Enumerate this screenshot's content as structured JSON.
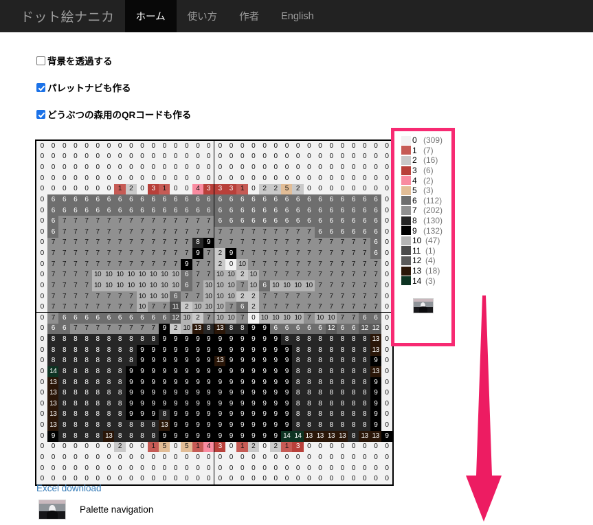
{
  "navbar": {
    "brand": "ドット絵ナニカ",
    "items": [
      {
        "label": "ホーム",
        "active": true
      },
      {
        "label": "使い方",
        "active": false
      },
      {
        "label": "作者",
        "active": false
      },
      {
        "label": "English",
        "active": false
      }
    ]
  },
  "options": [
    {
      "label": "背景を透過する",
      "checked": false
    },
    {
      "label": "パレットナビも作る",
      "checked": true
    },
    {
      "label": "どうぶつの森用のQRコードも作る",
      "checked": true
    }
  ],
  "legend": {
    "border_color": "#f72a72",
    "entries": [
      {
        "index": "0",
        "count": "(309)",
        "color": "#f2f2f2"
      },
      {
        "index": "1",
        "count": "(7)",
        "color": "#c65b55"
      },
      {
        "index": "2",
        "count": "(16)",
        "color": "#c9c9c9"
      },
      {
        "index": "3",
        "count": "(6)",
        "color": "#b8403a"
      },
      {
        "index": "4",
        "count": "(2)",
        "color": "#f98ba0"
      },
      {
        "index": "5",
        "count": "(3)",
        "color": "#e2bd96"
      },
      {
        "index": "6",
        "count": "(112)",
        "color": "#6e6e6e"
      },
      {
        "index": "7",
        "count": "(202)",
        "color": "#909090"
      },
      {
        "index": "8",
        "count": "(130)",
        "color": "#262626"
      },
      {
        "index": "9",
        "count": "(132)",
        "color": "#000000"
      },
      {
        "index": "10",
        "count": "(47)",
        "color": "#b4b4b4"
      },
      {
        "index": "11",
        "count": "(1)",
        "color": "#4b4b4b"
      },
      {
        "index": "12",
        "count": "(4)",
        "color": "#5a5a5a"
      },
      {
        "index": "13",
        "count": "(18)",
        "color": "#2a1608"
      },
      {
        "index": "14",
        "count": "(3)",
        "color": "#0d3322"
      }
    ],
    "thumbnail_name": "palette-navigation-thumbnail"
  },
  "links": {
    "excel_download": "Excel download",
    "palette_navigation": "Palette navigation"
  },
  "arrow": {
    "color": "#ed1c62",
    "direction": "down"
  },
  "grid": {
    "rows": 32,
    "cols": 32,
    "block_divider_col": 16,
    "block_divider_row": 16,
    "palette": {
      "0": "#f2f2f2",
      "1": "#c65b55",
      "2": "#c9c9c9",
      "3": "#b8403a",
      "4": "#f98ba0",
      "5": "#e2bd96",
      "6": "#6e6e6e",
      "7": "#909090",
      "8": "#262626",
      "9": "#000000",
      "10": "#b4b4b4",
      "11": "#4b4b4b",
      "12": "#5a5a5a",
      "13": "#2a1608",
      "14": "#0d3322"
    },
    "cells": [
      [
        0,
        0,
        0,
        0,
        0,
        0,
        0,
        0,
        0,
        0,
        0,
        0,
        0,
        0,
        0,
        0,
        0,
        0,
        0,
        0,
        0,
        0,
        0,
        0,
        0,
        0,
        0,
        0,
        0,
        0,
        0,
        0
      ],
      [
        0,
        0,
        0,
        0,
        0,
        0,
        0,
        0,
        0,
        0,
        0,
        0,
        0,
        0,
        0,
        0,
        0,
        0,
        0,
        0,
        0,
        0,
        0,
        0,
        0,
        0,
        0,
        0,
        0,
        0,
        0,
        0
      ],
      [
        0,
        0,
        0,
        0,
        0,
        0,
        0,
        0,
        0,
        0,
        0,
        0,
        0,
        0,
        0,
        0,
        0,
        0,
        0,
        0,
        0,
        0,
        0,
        0,
        0,
        0,
        0,
        0,
        0,
        0,
        0,
        0
      ],
      [
        0,
        0,
        0,
        0,
        0,
        0,
        0,
        0,
        0,
        0,
        0,
        0,
        0,
        0,
        0,
        0,
        0,
        0,
        0,
        0,
        0,
        0,
        0,
        0,
        0,
        0,
        0,
        0,
        0,
        0,
        0,
        0
      ],
      [
        0,
        0,
        0,
        0,
        0,
        0,
        0,
        1,
        2,
        0,
        3,
        1,
        0,
        0,
        4,
        3,
        3,
        3,
        1,
        0,
        2,
        2,
        5,
        2,
        0,
        0,
        0,
        0,
        0,
        0,
        0,
        0
      ],
      [
        0,
        6,
        6,
        6,
        6,
        6,
        6,
        6,
        6,
        6,
        6,
        6,
        6,
        6,
        6,
        6,
        6,
        6,
        6,
        6,
        6,
        6,
        6,
        6,
        6,
        6,
        6,
        6,
        6,
        6,
        6,
        0
      ],
      [
        0,
        6,
        6,
        6,
        6,
        6,
        6,
        6,
        6,
        6,
        6,
        6,
        6,
        6,
        6,
        6,
        6,
        6,
        6,
        6,
        6,
        6,
        6,
        6,
        6,
        6,
        6,
        6,
        6,
        6,
        6,
        0
      ],
      [
        0,
        6,
        7,
        7,
        7,
        7,
        7,
        7,
        7,
        7,
        7,
        7,
        7,
        7,
        7,
        7,
        6,
        6,
        6,
        6,
        6,
        6,
        6,
        6,
        6,
        6,
        6,
        6,
        6,
        6,
        6,
        0
      ],
      [
        0,
        6,
        7,
        7,
        7,
        7,
        7,
        7,
        7,
        7,
        7,
        7,
        7,
        7,
        7,
        7,
        7,
        7,
        7,
        7,
        7,
        7,
        7,
        7,
        7,
        6,
        6,
        6,
        6,
        6,
        6,
        0
      ],
      [
        0,
        7,
        7,
        7,
        7,
        7,
        7,
        7,
        7,
        7,
        7,
        7,
        7,
        7,
        8,
        9,
        7,
        7,
        7,
        7,
        7,
        7,
        7,
        7,
        7,
        7,
        7,
        7,
        7,
        7,
        6,
        0
      ],
      [
        0,
        7,
        7,
        7,
        7,
        7,
        7,
        7,
        7,
        7,
        7,
        7,
        7,
        7,
        9,
        7,
        2,
        9,
        7,
        7,
        7,
        7,
        7,
        7,
        7,
        7,
        7,
        7,
        7,
        7,
        6,
        0
      ],
      [
        0,
        7,
        7,
        7,
        7,
        7,
        7,
        7,
        7,
        7,
        7,
        7,
        7,
        9,
        7,
        7,
        2,
        0,
        10,
        7,
        7,
        7,
        7,
        7,
        7,
        7,
        7,
        7,
        7,
        7,
        7,
        0
      ],
      [
        0,
        7,
        7,
        7,
        7,
        10,
        10,
        10,
        10,
        10,
        10,
        10,
        10,
        6,
        7,
        7,
        10,
        10,
        2,
        10,
        7,
        7,
        7,
        7,
        7,
        7,
        7,
        7,
        7,
        7,
        7,
        0
      ],
      [
        0,
        7,
        7,
        7,
        7,
        10,
        10,
        10,
        10,
        10,
        10,
        10,
        10,
        6,
        7,
        10,
        10,
        10,
        7,
        10,
        6,
        10,
        10,
        10,
        10,
        7,
        7,
        7,
        7,
        7,
        7,
        0
      ],
      [
        0,
        7,
        7,
        7,
        7,
        7,
        7,
        7,
        7,
        10,
        10,
        10,
        6,
        7,
        7,
        10,
        10,
        10,
        2,
        2,
        7,
        7,
        7,
        7,
        7,
        7,
        7,
        7,
        7,
        7,
        7,
        0
      ],
      [
        0,
        7,
        7,
        7,
        7,
        7,
        7,
        7,
        7,
        10,
        7,
        7,
        11,
        2,
        10,
        10,
        10,
        7,
        6,
        2,
        7,
        7,
        7,
        7,
        7,
        7,
        7,
        7,
        7,
        7,
        7,
        0
      ],
      [
        0,
        7,
        6,
        6,
        6,
        6,
        6,
        6,
        6,
        6,
        6,
        6,
        12,
        10,
        2,
        7,
        10,
        10,
        7,
        0,
        10,
        10,
        10,
        10,
        7,
        10,
        10,
        7,
        7,
        6,
        6,
        0
      ],
      [
        0,
        6,
        6,
        7,
        7,
        7,
        7,
        7,
        7,
        7,
        7,
        9,
        2,
        10,
        13,
        8,
        13,
        8,
        8,
        9,
        9,
        6,
        6,
        6,
        6,
        6,
        12,
        6,
        6,
        12,
        12,
        0
      ],
      [
        0,
        8,
        8,
        8,
        8,
        8,
        8,
        8,
        8,
        8,
        8,
        9,
        9,
        9,
        9,
        9,
        9,
        9,
        9,
        9,
        9,
        9,
        8,
        8,
        8,
        8,
        8,
        8,
        8,
        8,
        13,
        0
      ],
      [
        0,
        8,
        8,
        8,
        8,
        8,
        8,
        8,
        8,
        9,
        9,
        9,
        9,
        9,
        9,
        9,
        9,
        9,
        9,
        9,
        9,
        9,
        9,
        8,
        8,
        8,
        8,
        8,
        8,
        8,
        13,
        0
      ],
      [
        0,
        8,
        8,
        8,
        8,
        8,
        8,
        8,
        8,
        9,
        9,
        9,
        9,
        9,
        9,
        9,
        13,
        9,
        9,
        9,
        9,
        9,
        9,
        8,
        8,
        8,
        8,
        8,
        8,
        8,
        9,
        0
      ],
      [
        0,
        14,
        8,
        8,
        8,
        8,
        8,
        8,
        9,
        9,
        9,
        9,
        9,
        9,
        9,
        9,
        9,
        9,
        9,
        9,
        9,
        9,
        9,
        8,
        8,
        8,
        8,
        8,
        8,
        8,
        13,
        0
      ],
      [
        0,
        13,
        8,
        8,
        8,
        8,
        8,
        8,
        9,
        9,
        9,
        9,
        9,
        9,
        9,
        9,
        9,
        9,
        9,
        9,
        9,
        9,
        9,
        8,
        8,
        8,
        8,
        8,
        8,
        8,
        9,
        0
      ],
      [
        0,
        13,
        8,
        8,
        8,
        8,
        8,
        8,
        9,
        9,
        9,
        9,
        9,
        9,
        9,
        9,
        9,
        9,
        9,
        9,
        9,
        9,
        9,
        8,
        8,
        8,
        8,
        8,
        8,
        8,
        9,
        0
      ],
      [
        0,
        13,
        8,
        8,
        8,
        8,
        8,
        8,
        9,
        9,
        9,
        9,
        9,
        9,
        9,
        9,
        9,
        9,
        9,
        9,
        9,
        9,
        9,
        8,
        8,
        8,
        8,
        8,
        8,
        8,
        9,
        0
      ],
      [
        0,
        13,
        8,
        8,
        8,
        8,
        8,
        8,
        9,
        9,
        9,
        8,
        9,
        9,
        9,
        9,
        9,
        9,
        9,
        9,
        9,
        9,
        9,
        8,
        8,
        8,
        8,
        8,
        8,
        8,
        9,
        0
      ],
      [
        0,
        13,
        8,
        8,
        8,
        8,
        8,
        8,
        8,
        8,
        8,
        13,
        9,
        9,
        9,
        9,
        9,
        9,
        9,
        9,
        9,
        9,
        9,
        8,
        8,
        8,
        8,
        8,
        8,
        8,
        9,
        0
      ],
      [
        0,
        9,
        8,
        8,
        8,
        8,
        13,
        8,
        8,
        8,
        8,
        9,
        9,
        9,
        9,
        9,
        9,
        9,
        9,
        9,
        9,
        9,
        14,
        14,
        13,
        13,
        13,
        13,
        8,
        13,
        13,
        9
      ],
      [
        0,
        0,
        0,
        0,
        0,
        0,
        0,
        2,
        0,
        0,
        1,
        5,
        0,
        5,
        1,
        4,
        3,
        0,
        1,
        2,
        0,
        2,
        1,
        3,
        0,
        0,
        0,
        0,
        0,
        0,
        0,
        0
      ],
      [
        0,
        0,
        0,
        0,
        0,
        0,
        0,
        0,
        0,
        0,
        0,
        0,
        0,
        0,
        0,
        0,
        0,
        0,
        0,
        0,
        0,
        0,
        0,
        0,
        0,
        0,
        0,
        0,
        0,
        0,
        0,
        0
      ],
      [
        0,
        0,
        0,
        0,
        0,
        0,
        0,
        0,
        0,
        0,
        0,
        0,
        0,
        0,
        0,
        0,
        0,
        0,
        0,
        0,
        0,
        0,
        0,
        0,
        0,
        0,
        0,
        0,
        0,
        0,
        0,
        0
      ],
      [
        0,
        0,
        0,
        0,
        0,
        0,
        0,
        0,
        0,
        0,
        0,
        0,
        0,
        0,
        0,
        0,
        0,
        0,
        0,
        0,
        0,
        0,
        0,
        0,
        0,
        0,
        0,
        0,
        0,
        0,
        0,
        0
      ]
    ]
  }
}
